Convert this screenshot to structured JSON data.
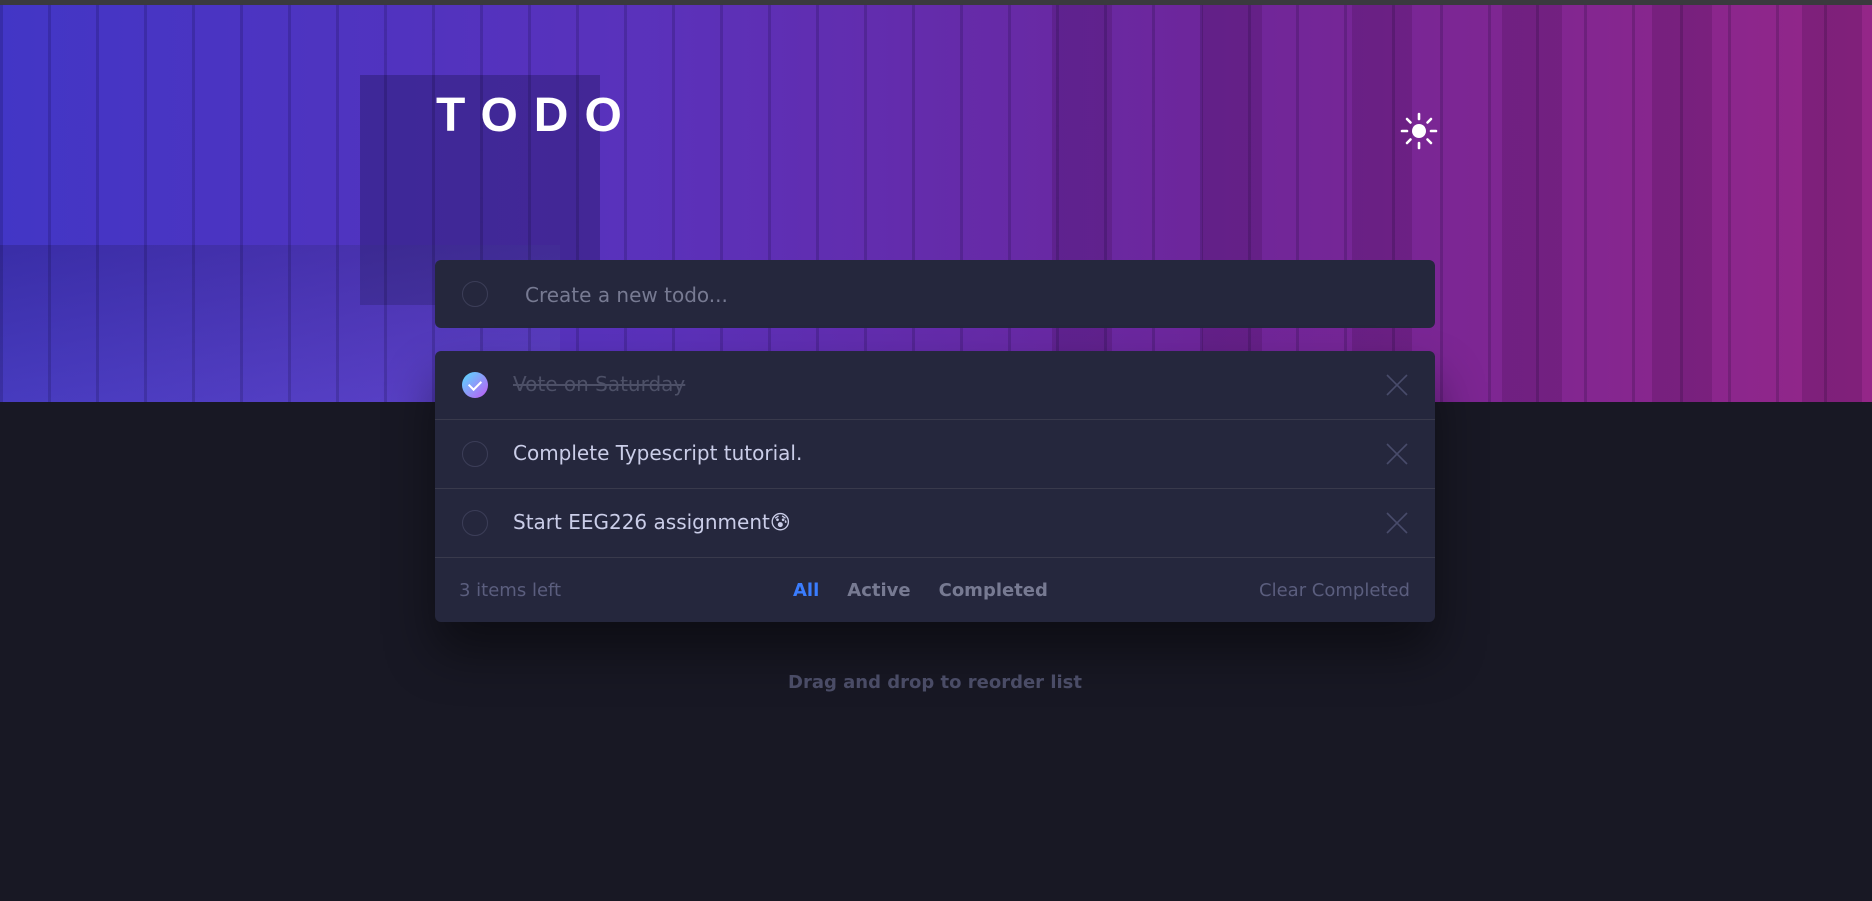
{
  "app": {
    "title": "TODO",
    "theme_icon": "sun-icon"
  },
  "new_todo": {
    "placeholder": "Create a new todo..."
  },
  "todos": [
    {
      "text": "Vote on Saturday",
      "completed": true
    },
    {
      "text": "Complete Typescript tutorial.",
      "completed": false
    },
    {
      "text": "Start EEG226 assignment",
      "emoji": "😰",
      "completed": false
    }
  ],
  "footer": {
    "items_left": "3 items left",
    "filters": [
      "All",
      "Active",
      "Completed"
    ],
    "active_filter": "All",
    "clear_label": "Clear Completed"
  },
  "hint": "Drag and drop to reorder list",
  "colors": {
    "background": "#181824",
    "card": "#25273d",
    "accent": "#3a7cfd",
    "check_gradient_start": "#57ddff",
    "check_gradient_end": "#c058f3"
  }
}
